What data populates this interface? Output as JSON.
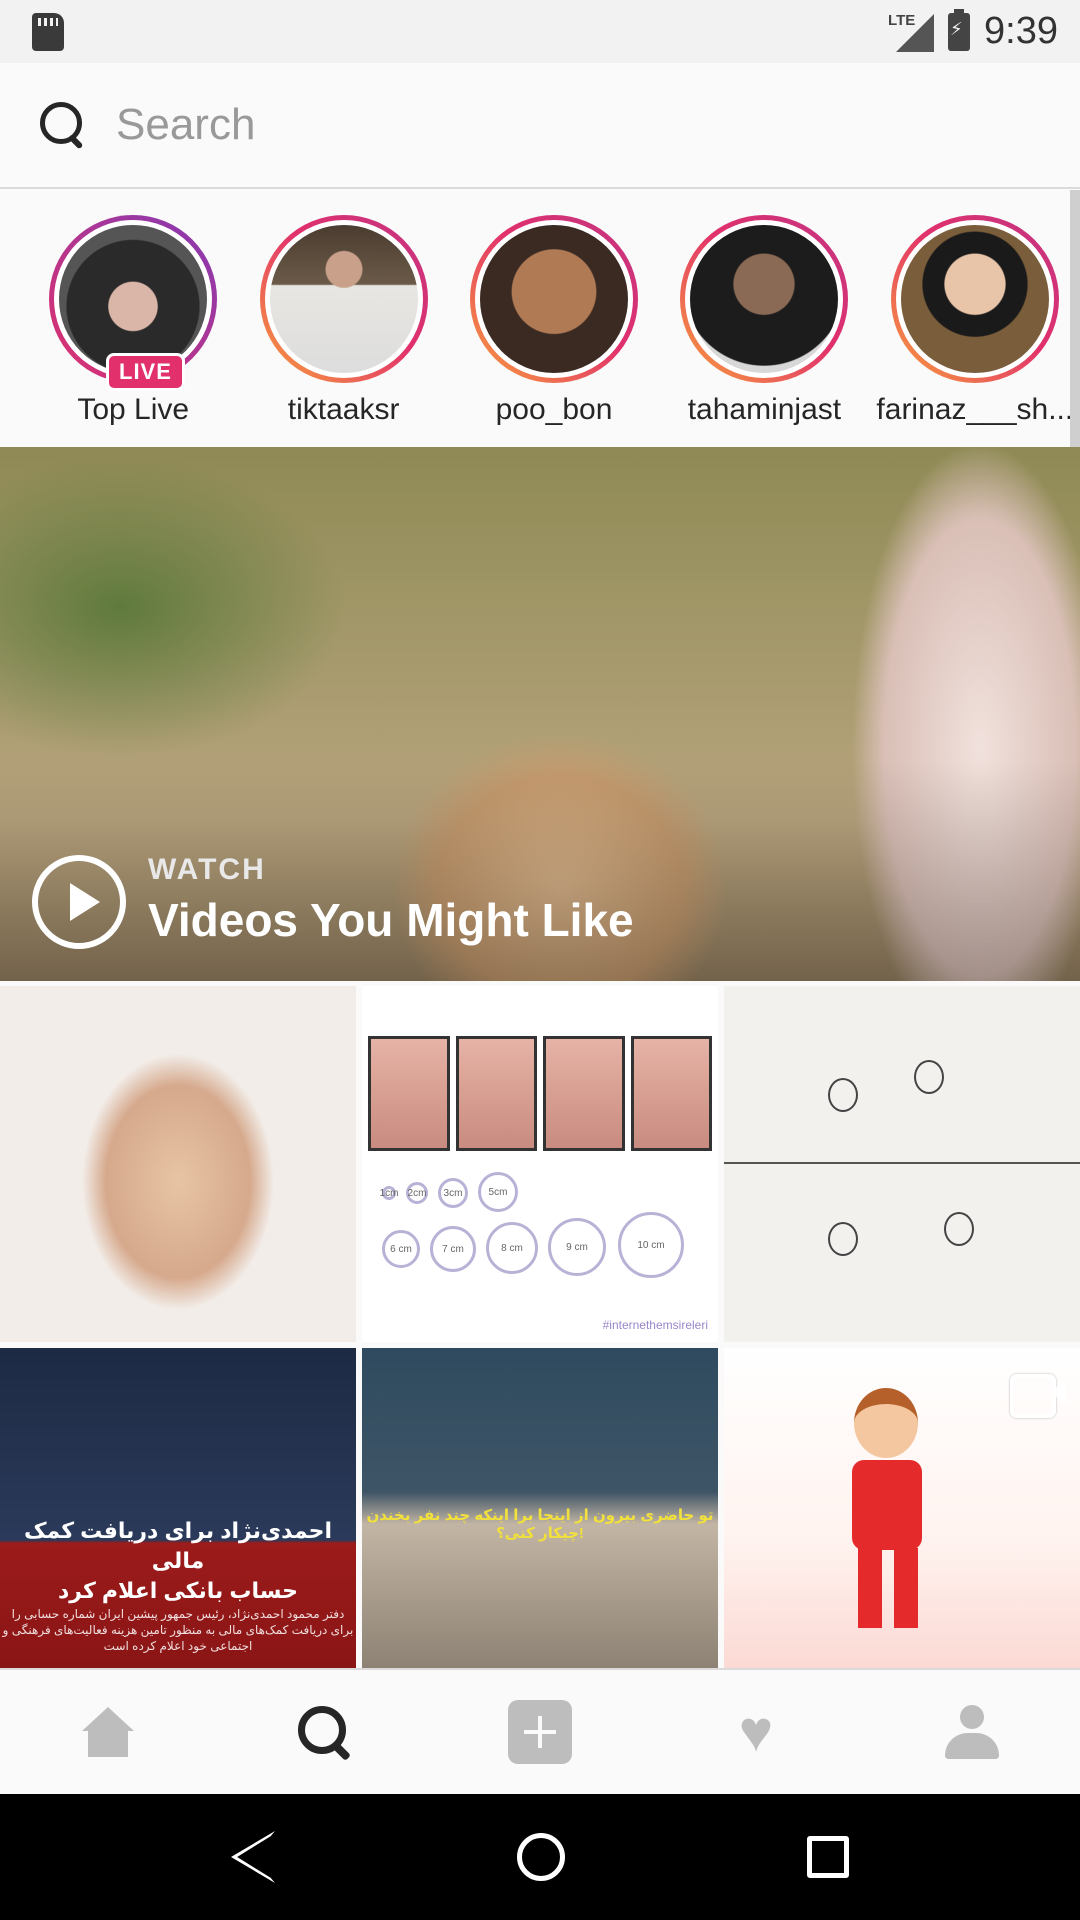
{
  "status_bar": {
    "network": "LTE",
    "time": "9:39"
  },
  "search": {
    "placeholder": "Search"
  },
  "stories": [
    {
      "name": "Top Live",
      "badge": "LIVE"
    },
    {
      "name": "tiktaaksr"
    },
    {
      "name": "poo_bon"
    },
    {
      "name": "tahaminjast"
    },
    {
      "name": "farinaz___sh..."
    }
  ],
  "hero": {
    "eyebrow": "WATCH",
    "title": "Videos You Might Like"
  },
  "grid": {
    "tile1_tag": "#internethemsireleri",
    "tile1_sizes": [
      "1cm",
      "2cm",
      "3cm",
      "5cm",
      "6 cm",
      "7 cm",
      "8 cm",
      "9 cm",
      "10 cm"
    ],
    "tile3_headline_1": "احمدی‌نژاد برای دریافت کمک مالی",
    "tile3_headline_2": "حساب بانکی اعلام کرد",
    "tile3_body": "دفتر محمود احمدی‌نژاد، رئیس جمهور پیشین ایران شماره حسابی را برای دریافت کمک‌های مالی به منظور تامین هزینه فعالیت‌های فرهنگی و اجتماعی خود اعلام کرده است",
    "tile4_subtitle": "تو حاضری بیرون از اینجا برا اینکه چند نفر بخندن چیکار کنی؟!"
  },
  "bottom_nav": {
    "items": [
      "home-icon",
      "search-icon",
      "add-icon",
      "heart-icon",
      "profile-icon"
    ],
    "active": "search-icon"
  },
  "colors": {
    "accent": "#e1306c",
    "active_icon": "#262626",
    "inactive_icon": "#bdbdbd"
  }
}
